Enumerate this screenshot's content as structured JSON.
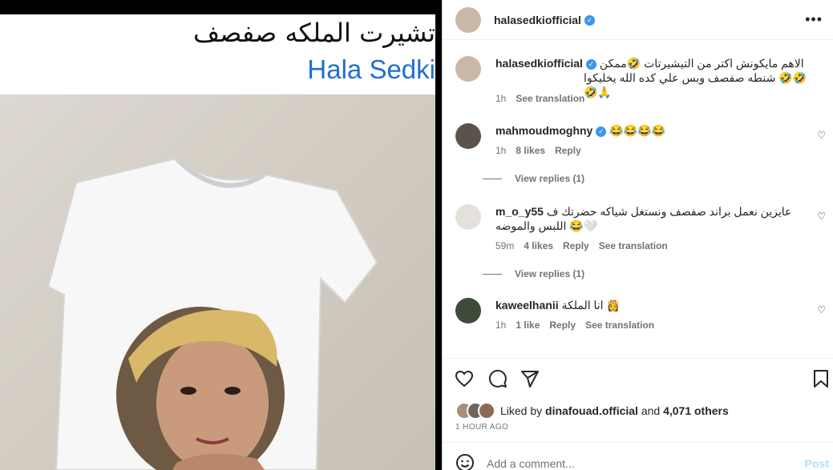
{
  "media": {
    "title_ar": "تشيرت الملكه صفصف",
    "title_en": "Hala Sedki"
  },
  "post": {
    "author": "halasedkiofficial",
    "caption_ar_1": "الاهم مايكونش اكتر من التيشيرتات 🤣ممكن",
    "caption_ar_2": "شنطه صفصف وبس علي كده الله يخليكوا 🤣🤣🤣🙏",
    "caption_time": "1h",
    "see_translation": "See translation"
  },
  "comments": [
    {
      "user": "mahmoudmoghny",
      "verified": true,
      "text": "😂😂😂😂",
      "time": "1h",
      "likes": "8 likes",
      "reply": "Reply",
      "translation": "",
      "view_replies": "View replies (1)"
    },
    {
      "user": "m_o_y55",
      "verified": false,
      "text": "عايزين نعمل براند صفصف ونستغل شياكه حضرتك ف",
      "text2": "اللبس والموضه 😂🤍",
      "time": "59m",
      "likes": "4 likes",
      "reply": "Reply",
      "translation": "See translation",
      "view_replies": "View replies (1)"
    },
    {
      "user": "kaweelhanii",
      "verified": false,
      "text": "انا الملكة 👸",
      "time": "1h",
      "likes": "1 like",
      "reply": "Reply",
      "translation": "See translation",
      "view_replies": ""
    }
  ],
  "likes": {
    "prefix": "Liked by",
    "user": "dinafouad.official",
    "and": "and",
    "count": "4,071 others"
  },
  "time_ago": "1 HOUR AGO",
  "add_comment": {
    "placeholder": "Add a comment...",
    "post_label": "Post"
  },
  "colors": {
    "accent": "#3897f0",
    "link": "#1f6fd1",
    "post_disabled": "#b2dffc"
  },
  "icons": [
    "more-icon",
    "verified-icon",
    "heart-icon",
    "comment-icon",
    "share-icon",
    "bookmark-icon",
    "emoji-icon"
  ]
}
